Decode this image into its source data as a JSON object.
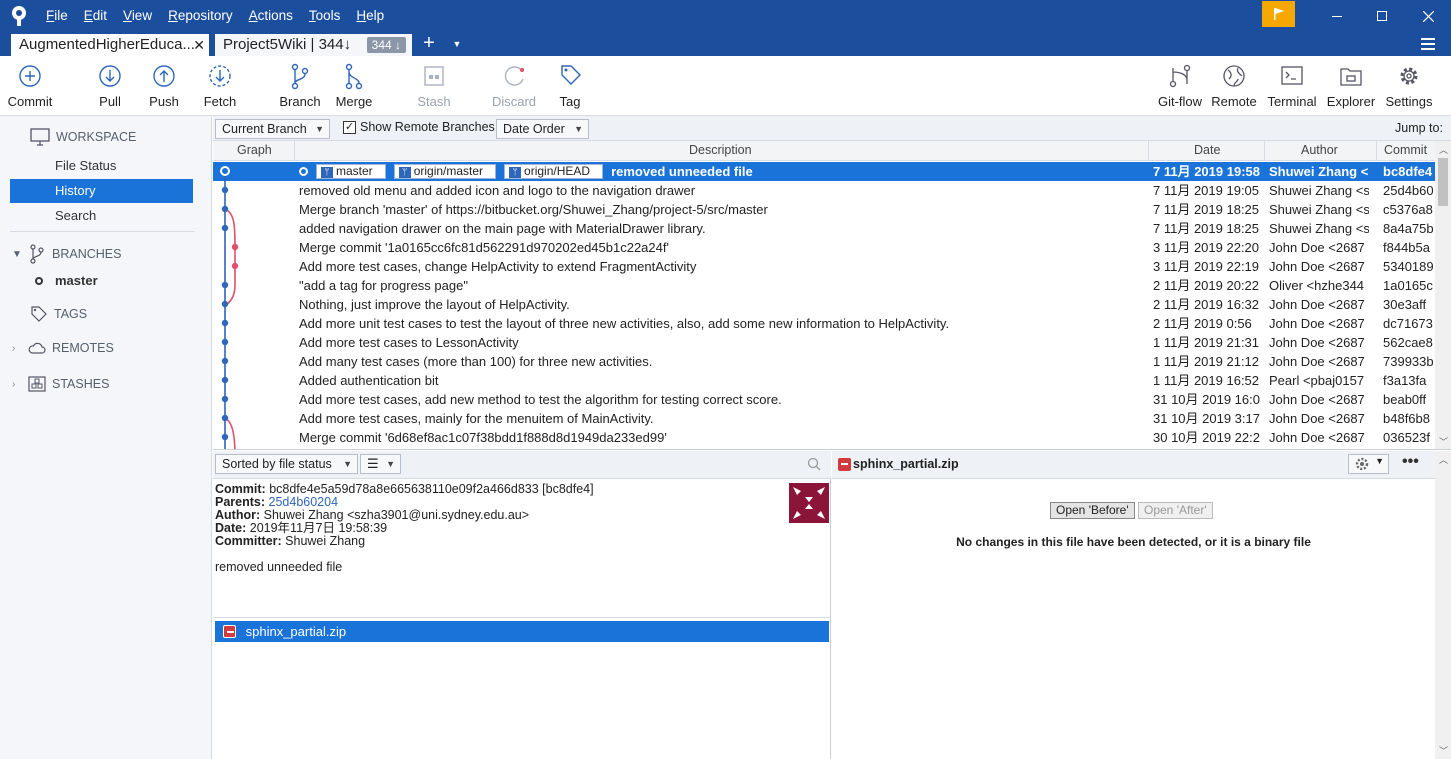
{
  "menu": [
    "File",
    "Edit",
    "View",
    "Repository",
    "Actions",
    "Tools",
    "Help"
  ],
  "tabs": [
    {
      "label": "AugmentedHigherEduca..."
    },
    {
      "label": "Project5Wiki | 344↓",
      "badge": "344 ↓"
    }
  ],
  "toolbar": {
    "commit": "Commit",
    "pull": "Pull",
    "push": "Push",
    "fetch": "Fetch",
    "branch": "Branch",
    "merge": "Merge",
    "stash": "Stash",
    "discard": "Discard",
    "tag": "Tag",
    "gitflow": "Git-flow",
    "remote": "Remote",
    "terminal": "Terminal",
    "explorer": "Explorer",
    "settings": "Settings"
  },
  "sidebar": {
    "workspace": "WORKSPACE",
    "file_status": "File Status",
    "history": "History",
    "search": "Search",
    "branches": "BRANCHES",
    "master": "master",
    "tags": "TAGS",
    "remotes": "REMOTES",
    "stashes": "STASHES"
  },
  "filter": {
    "branch_select": "Current Branch",
    "show_remote": "Show Remote Branches",
    "order_select": "Date Order",
    "jump_to": "Jump to:"
  },
  "columns": {
    "graph": "Graph",
    "description": "Description",
    "date": "Date",
    "author": "Author",
    "commit": "Commit"
  },
  "selected_commit": {
    "refs": [
      "master",
      "origin/master",
      "origin/HEAD"
    ],
    "description": "removed unneeded file",
    "date": "7 11月 2019 19:58",
    "author": "Shuwei Zhang <s",
    "commit": "bc8dfe4"
  },
  "commits": [
    {
      "description": "removed old menu and added icon and logo to the navigation drawer",
      "date": "7 11月 2019 19:05",
      "author": "Shuwei Zhang <s",
      "commit": "25d4b60"
    },
    {
      "description": "Merge branch 'master' of https://bitbucket.org/Shuwei_Zhang/project-5/src/master",
      "date": "7 11月 2019 18:25",
      "author": "Shuwei Zhang <s",
      "commit": "c5376a8"
    },
    {
      "description": "added navigation drawer on the main page with MaterialDrawer library.",
      "date": "7 11月 2019 18:25",
      "author": "Shuwei Zhang <s",
      "commit": "8a4a75b"
    },
    {
      "description": "Merge commit '1a0165cc6fc81d562291d970202ed45b1c22a24f'",
      "date": "3 11月 2019 22:20",
      "author": "John Doe <2687",
      "commit": "f844b5a"
    },
    {
      "description": "Add more test cases, change HelpActivity to extend FragmentActivity",
      "date": "3 11月 2019 22:19",
      "author": "John Doe <2687",
      "commit": "5340189"
    },
    {
      "description": "\"add a tag for progress page\"",
      "date": "2 11月 2019 20:22",
      "author": "Oliver <hzhe344",
      "commit": "1a0165c"
    },
    {
      "description": "Nothing, just improve the layout of HelpActivity.",
      "date": "2 11月 2019 16:32",
      "author": "John Doe <2687",
      "commit": "30e3aff"
    },
    {
      "description": "Add more unit test cases to test the layout of three new activities, also, add some new information to HelpActivity.",
      "date": "2 11月 2019 0:56",
      "author": "John Doe <2687",
      "commit": "dc71673"
    },
    {
      "description": "Add more test cases to LessonActivity",
      "date": "1 11月 2019 21:31",
      "author": "John Doe <2687",
      "commit": "562cae8"
    },
    {
      "description": "Add many test cases (more than 100) for three new activities.",
      "date": "1 11月 2019 21:12",
      "author": "John Doe <2687",
      "commit": "739933b"
    },
    {
      "description": "Added authentication bit",
      "date": "1 11月 2019 16:52",
      "author": "Pearl <pbaj0157",
      "commit": "f3a13fa"
    },
    {
      "description": "Add more test cases, add new method to test the algorithm for testing correct score.",
      "date": "31 10月 2019 16:0",
      "author": "John Doe <2687",
      "commit": "beab0ff"
    },
    {
      "description": "Add more test cases, mainly for the menuitem of MainActivity.",
      "date": "31 10月 2019 3:17",
      "author": "John Doe <2687",
      "commit": "b48f6b8"
    },
    {
      "description": "Merge commit '6d68ef8ac1c07f38bdd1f888d8d1949da233ed99'",
      "date": "30 10月 2019 22:2",
      "author": "John Doe <2687",
      "commit": "036523f"
    }
  ],
  "details": {
    "sort_select": "Sorted by file status",
    "commit_label": "Commit:",
    "commit_value": "bc8dfe4e5a59d78a8e665638110e09f2a466d833 [bc8dfe4]",
    "parents_label": "Parents:",
    "parents_value": "25d4b60204",
    "author_label": "Author:",
    "author_value": "Shuwei Zhang <szha3901@uni.sydney.edu.au>",
    "date_label": "Date:",
    "date_value": "2019年11月7日 19:58:39",
    "committer_label": "Committer:",
    "committer_value": "Shuwei Zhang",
    "message": "removed unneeded file",
    "file": "sphinx_partial.zip"
  },
  "diff": {
    "file": "sphinx_partial.zip",
    "open_before": "Open 'Before'",
    "open_after": "Open 'After'",
    "message": "No changes in this file have been detected, or it is a binary file"
  },
  "colors": {
    "accent": "#1a73d9",
    "titlebar": "#1c4e9e",
    "graph_blue": "#2e66b9",
    "graph_red": "#e0506a"
  }
}
